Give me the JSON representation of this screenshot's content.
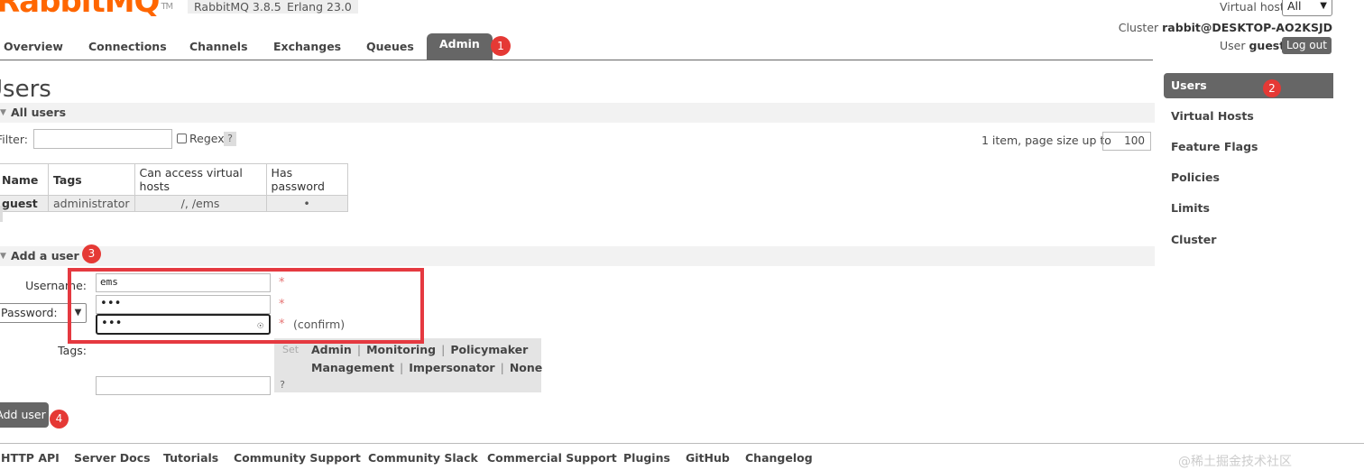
{
  "header": {
    "logo_text": "RabbitMQ",
    "logo_tm": "TM",
    "rabbit_version": "RabbitMQ 3.8.5",
    "erlang_version": "Erlang 23.0",
    "virtual_host_label": "Virtual host",
    "virtual_host_value": "All",
    "cluster_label": "Cluster",
    "cluster_name": "rabbit@DESKTOP-AO2KSJD",
    "user_label": "User",
    "user_name": "guest",
    "logout_label": "Log out"
  },
  "tabs": [
    {
      "label": "Overview"
    },
    {
      "label": "Connections"
    },
    {
      "label": "Channels"
    },
    {
      "label": "Exchanges"
    },
    {
      "label": "Queues"
    },
    {
      "label": "Admin",
      "active": true
    }
  ],
  "sidebar": {
    "items": [
      {
        "label": "Users",
        "active": true
      },
      {
        "label": "Virtual Hosts"
      },
      {
        "label": "Feature Flags"
      },
      {
        "label": "Policies"
      },
      {
        "label": "Limits"
      },
      {
        "label": "Cluster"
      }
    ]
  },
  "markers": [
    "1",
    "2",
    "3",
    "4"
  ],
  "page": {
    "title": "Users",
    "all_users_section": "All users",
    "filter_label": "Filter:",
    "filter_value": "",
    "regex_label": "Regex",
    "help": "?",
    "page_info": "1 item, page size up to",
    "page_size": "100"
  },
  "users_table": {
    "headers": [
      "Name",
      "Tags",
      "Can access virtual hosts",
      "Has password"
    ],
    "rows": [
      {
        "name": "guest",
        "tags": "administrator",
        "vhosts": "/, /ems",
        "has_password": "•"
      }
    ]
  },
  "add_user": {
    "section": "Add a user",
    "username_label": "Username:",
    "username_value": "ems",
    "password_mode": "Password:",
    "password_value": "•••",
    "confirm_value": "•••",
    "required_mark": "*",
    "confirm_label": "(confirm)",
    "tags_label": "Tags:",
    "set_label": "Set",
    "tag_options_row1": [
      "Admin",
      "Monitoring",
      "Policymaker"
    ],
    "tag_options_row2": [
      "Management",
      "Impersonator",
      "None"
    ],
    "tags_value": "",
    "submit_label": "Add user"
  },
  "footer": {
    "links": [
      "HTTP API",
      "Server Docs",
      "Tutorials",
      "Community Support",
      "Community Slack",
      "Commercial Support",
      "Plugins",
      "GitHub",
      "Changelog"
    ]
  },
  "watermark": "@稀土掘金技术社区",
  "colors": {
    "accent": "#666666",
    "brand": "#ff6600",
    "marker": "#e53935",
    "highlight_box": "#e53940"
  }
}
